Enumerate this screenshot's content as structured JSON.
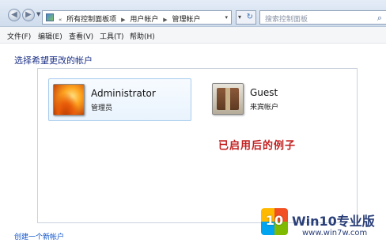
{
  "address_bar": {
    "breadcrumbs": [
      "所有控制面板项",
      "用户帐户",
      "管理帐户"
    ],
    "overflow_glyph": "«",
    "search_placeholder": "搜索控制面板",
    "refresh_glyph": "↻",
    "dropdown_glyph": "▾"
  },
  "menu": {
    "items": [
      "文件(F)",
      "编辑(E)",
      "查看(V)",
      "工具(T)",
      "帮助(H)"
    ]
  },
  "main": {
    "heading": "选择希望更改的帐户",
    "accounts": [
      {
        "name": "Administrator",
        "role": "管理员",
        "picture": "orange-flower-picture",
        "selected": true
      },
      {
        "name": "Guest",
        "role": "来宾帐户",
        "picture": "briefcase-picture",
        "selected": false
      }
    ],
    "annotation": "已启用后的例子",
    "create_link": "创建一个新帐户"
  },
  "watermark": {
    "logo_text": "10",
    "title": "Win10专业版",
    "url": "www.win7w.com"
  },
  "icons": {
    "back": "back-arrow-icon",
    "forward": "forward-arrow-icon",
    "control_panel": "control-panel-icon",
    "search": "search-icon"
  },
  "colors": {
    "heading": "#1e3287",
    "annotation": "#c32020",
    "link": "#1155cc",
    "selection_border": "#a8cbed"
  }
}
